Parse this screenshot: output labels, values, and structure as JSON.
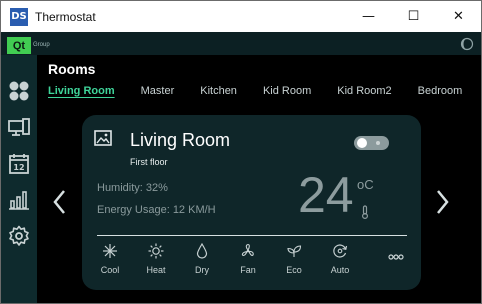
{
  "window": {
    "app_icon_text": "DS",
    "title": "Thermostat",
    "controls": [
      "—",
      "☐",
      "✕"
    ]
  },
  "qt": {
    "logo": "Qt",
    "group": "Group"
  },
  "sidebar": {
    "items": [
      "dashboard-icon",
      "devices-icon",
      "calendar-icon",
      "stats-icon",
      "settings-icon"
    ]
  },
  "rooms": {
    "title": "Rooms",
    "tabs": [
      "Living Room",
      "Master",
      "Kitchen",
      "Kid Room",
      "Kid Room2",
      "Bedroom"
    ],
    "active_tab": 0
  },
  "card": {
    "room_name": "Living Room",
    "floor": "First floor",
    "power_on": false,
    "humidity": "Humidity: 32%",
    "energy": "Energy Usage: 12 KM/H",
    "temperature": "24",
    "unit": "oC",
    "modes": [
      {
        "label": "Cool",
        "icon": "snowflake-icon"
      },
      {
        "label": "Heat",
        "icon": "sun-icon"
      },
      {
        "label": "Dry",
        "icon": "droplet-icon"
      },
      {
        "label": "Fan",
        "icon": "fan-icon"
      },
      {
        "label": "Eco",
        "icon": "leaf-icon"
      },
      {
        "label": "Auto",
        "icon": "auto-icon"
      }
    ]
  },
  "colors": {
    "accent": "#3fd49a",
    "card_bg": "#0f2629",
    "sidebar_bg": "#0e2a2d",
    "qt_green": "#41cd52"
  }
}
